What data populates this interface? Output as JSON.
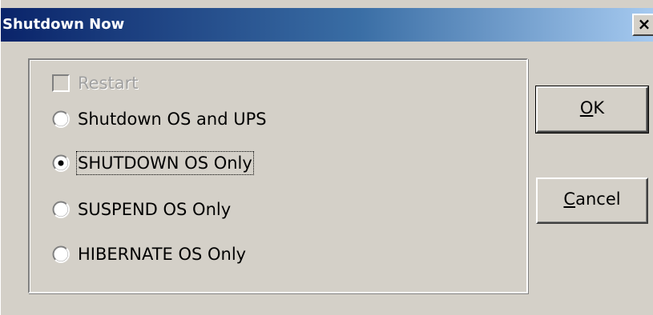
{
  "window": {
    "title": "Shutdown Now",
    "close_glyph": "✕"
  },
  "options": {
    "restart_checkbox": {
      "label": "Restart",
      "checked": false,
      "enabled": false
    },
    "radio_items": [
      {
        "label": "Shutdown OS and UPS",
        "selected": false
      },
      {
        "label": "SHUTDOWN OS Only",
        "selected": true
      },
      {
        "label": "SUSPEND OS Only",
        "selected": false
      },
      {
        "label": "HIBERNATE OS Only",
        "selected": false
      }
    ]
  },
  "buttons": {
    "ok_label": "OK",
    "cancel_label": "Cancel"
  },
  "colors": {
    "dialog_face": "#d4d0c8",
    "titlebar_start": "#0a246a",
    "titlebar_end": "#a6caf0",
    "disabled_text": "#a0a0a0"
  }
}
